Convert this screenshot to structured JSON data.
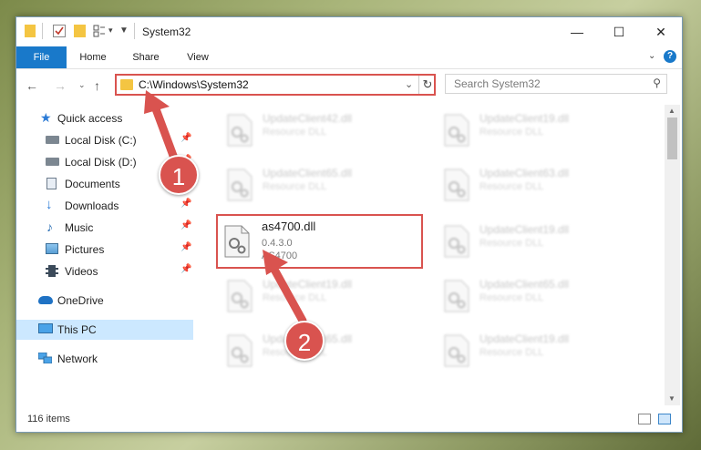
{
  "window": {
    "title": "System32",
    "controls": {
      "minimize": "—",
      "maximize": "☐",
      "close": "✕"
    }
  },
  "ribbon": {
    "tabs": [
      "File",
      "Home",
      "Share",
      "View"
    ],
    "help": "?"
  },
  "address": {
    "path": "C:\\Windows\\System32",
    "search_placeholder": "Search System32"
  },
  "sidebar": {
    "items": [
      {
        "label": "Quick access",
        "icon": "star-icon"
      },
      {
        "label": "Local Disk (C:)",
        "icon": "drive-icon",
        "pinned": true
      },
      {
        "label": "Local Disk (D:)",
        "icon": "drive-icon",
        "pinned": true
      },
      {
        "label": "Documents",
        "icon": "documents-icon",
        "pinned": true
      },
      {
        "label": "Downloads",
        "icon": "downloads-icon",
        "pinned": true
      },
      {
        "label": "Music",
        "icon": "music-icon",
        "pinned": true
      },
      {
        "label": "Pictures",
        "icon": "pictures-icon",
        "pinned": true
      },
      {
        "label": "Videos",
        "icon": "videos-icon",
        "pinned": true
      },
      {
        "label": "OneDrive",
        "icon": "cloud-icon"
      },
      {
        "label": "This PC",
        "icon": "computer-icon",
        "selected": true
      },
      {
        "label": "Network",
        "icon": "network-icon"
      }
    ]
  },
  "files": [
    {
      "name": "UpdateClient42.dll",
      "line1": "Resource DLL",
      "line2": ""
    },
    {
      "name": "UpdateClient19.dll",
      "line1": "Resource DLL",
      "line2": ""
    },
    {
      "name": "UpdateClient65.dll",
      "line1": "Resource DLL",
      "line2": ""
    },
    {
      "name": "UpdateClient63.dll",
      "line1": "Resource DLL",
      "line2": ""
    },
    {
      "name": "as4700.dll",
      "line1": "0.4.3.0",
      "line2": "AS4700"
    },
    {
      "name": "UpdateClient19.dll",
      "line1": "Resource DLL",
      "line2": ""
    },
    {
      "name": "UpdateClient19.dll",
      "line1": "Resource DLL",
      "line2": ""
    },
    {
      "name": "UpdateClient65.dll",
      "line1": "Resource DLL",
      "line2": ""
    },
    {
      "name": "UpdateClient65.dll",
      "line1": "Resource DLL",
      "line2": ""
    },
    {
      "name": "UpdateClient19.dll",
      "line1": "Resource DLL",
      "line2": ""
    },
    {
      "name": "UpdateClient65.dll",
      "line1": "Resource DLL",
      "line2": ""
    },
    {
      "name": "UpdateClient19.dll",
      "line1": "Resource DLL",
      "line2": ""
    }
  ],
  "status": {
    "count": "116 items"
  },
  "callouts": {
    "one": "1",
    "two": "2"
  },
  "colors": {
    "accent": "#1979ca",
    "highlight": "#d9534f",
    "selected": "#cce8ff"
  }
}
